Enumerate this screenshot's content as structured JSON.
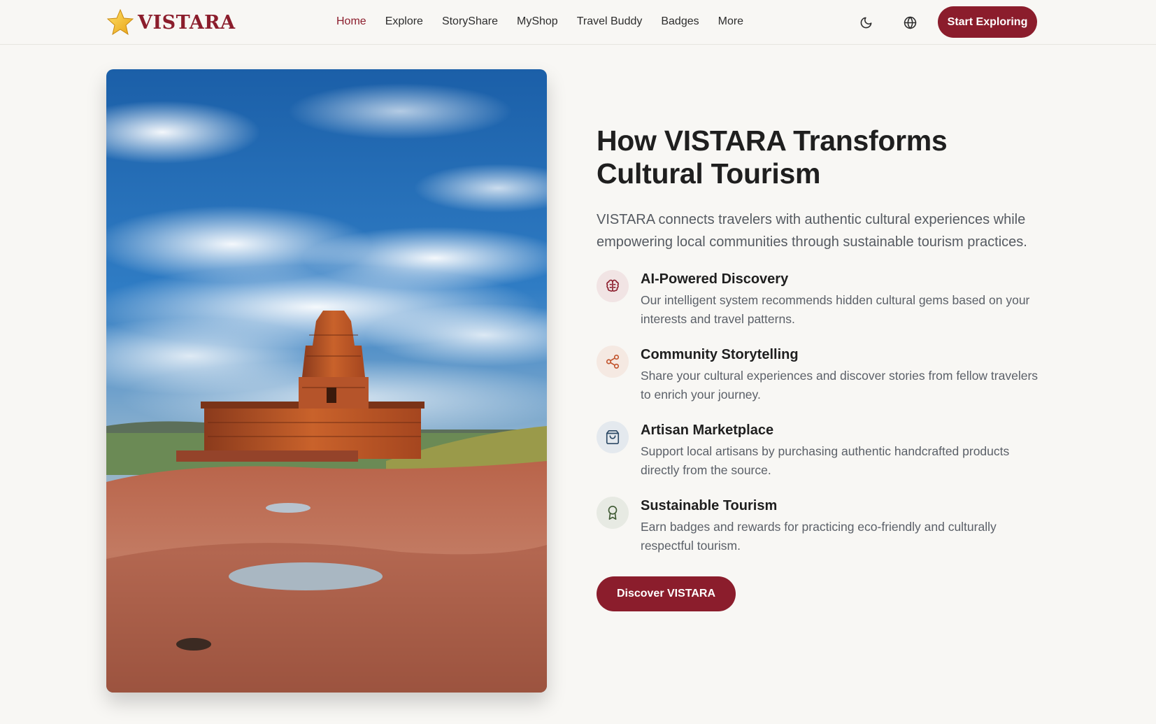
{
  "brand": {
    "name": "VISTARA",
    "logo_icon": "star-icon"
  },
  "nav": {
    "items": [
      {
        "label": "Home",
        "active": true
      },
      {
        "label": "Explore",
        "active": false
      },
      {
        "label": "StoryShare",
        "active": false
      },
      {
        "label": "MyShop",
        "active": false
      },
      {
        "label": "Travel Buddy",
        "active": false
      },
      {
        "label": "Badges",
        "active": false
      },
      {
        "label": "More",
        "active": false
      }
    ],
    "theme_icon": "moon-icon",
    "language_icon": "globe-icon",
    "cta_label": "Start Exploring"
  },
  "hero": {
    "image_subject": "ancient sandstone temple on rocky plateau under blue sky with clouds"
  },
  "section": {
    "title": "How VISTARA Transforms Cultural Tourism",
    "intro": "VISTARA connects travelers with authentic cultural experiences while empowering local communities through sustainable tourism practices.",
    "features": [
      {
        "icon": "brain-icon",
        "title": "AI-Powered Discovery",
        "description": "Our intelligent system recommends hidden cultural gems based on your interests and travel patterns."
      },
      {
        "icon": "share-icon",
        "title": "Community Storytelling",
        "description": "Share your cultural experiences and discover stories from fellow travelers to enrich your journey."
      },
      {
        "icon": "shopping-bag-icon",
        "title": "Artisan Marketplace",
        "description": "Support local artisans by purchasing authentic handcrafted products directly from the source."
      },
      {
        "icon": "award-icon",
        "title": "Sustainable Tourism",
        "description": "Earn badges and rewards for practicing eco-friendly and culturally respectful tourism."
      }
    ],
    "cta_label": "Discover VISTARA"
  },
  "colors": {
    "brand": "#8b1d2c",
    "background": "#f8f7f4",
    "text": "#1f1f1f",
    "muted": "#5b6068"
  }
}
